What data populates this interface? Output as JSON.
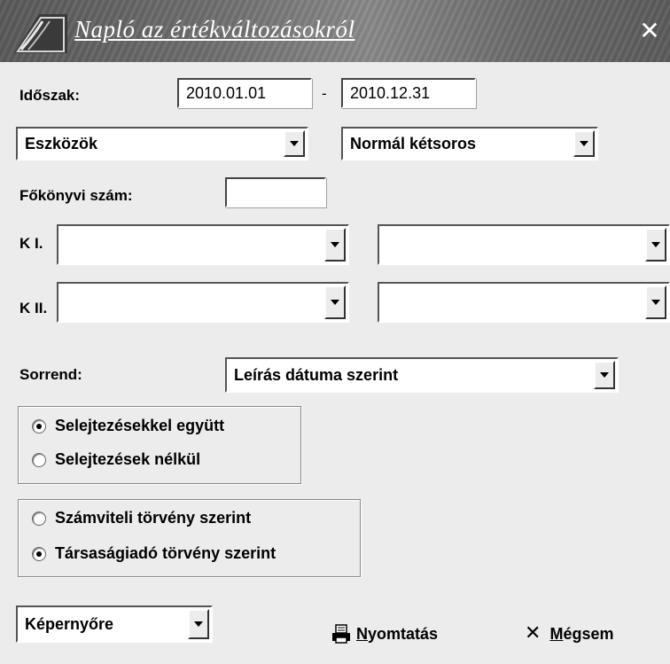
{
  "window": {
    "title": "Napló az értékváltozásokról",
    "close_glyph": "✕"
  },
  "period": {
    "label": "Időszak:",
    "from": "2010.01.01",
    "separator": "-",
    "to": "2010.12.31"
  },
  "asset_type": {
    "selected": "Eszközök"
  },
  "format": {
    "selected": "Normál kétsoros"
  },
  "ledger": {
    "label": "Főkönyvi szám:",
    "value": ""
  },
  "k1": {
    "label": "K I.",
    "left": "",
    "right": ""
  },
  "k2": {
    "label": "K II.",
    "left": "",
    "right": ""
  },
  "order": {
    "label": "Sorrend:",
    "selected": "Leírás dátuma szerint"
  },
  "disposal": {
    "options": [
      {
        "label": "Selejtezésekkel együtt",
        "checked": true
      },
      {
        "label": "Selejtezések nélkül",
        "checked": false
      }
    ]
  },
  "law": {
    "options": [
      {
        "label": "Számviteli törvény szerint",
        "checked": false
      },
      {
        "label": "Társaságiadó törvény szerint",
        "checked": true
      }
    ]
  },
  "output": {
    "selected": "Képernyőre"
  },
  "actions": {
    "print": {
      "first": "N",
      "rest": "yomtatás",
      "icon": "printer-icon"
    },
    "cancel": {
      "first": "M",
      "rest": "égsem",
      "icon": "close-icon"
    }
  }
}
